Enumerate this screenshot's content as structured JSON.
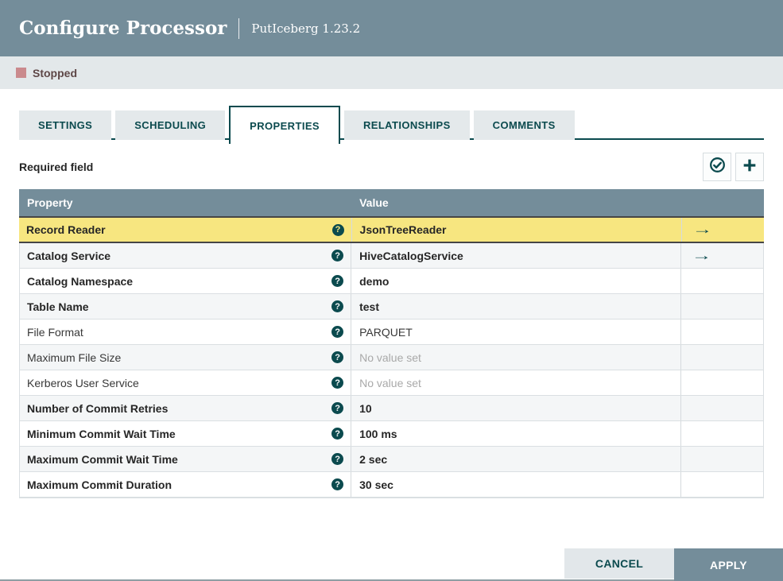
{
  "dialog": {
    "title": "Configure Processor",
    "subtitle": "PutIceberg 1.23.2"
  },
  "status_bar": {
    "label": "Stopped"
  },
  "tabs": [
    {
      "label": "SETTINGS",
      "active": false
    },
    {
      "label": "SCHEDULING",
      "active": false
    },
    {
      "label": "PROPERTIES",
      "active": true
    },
    {
      "label": "RELATIONSHIPS",
      "active": false
    },
    {
      "label": "COMMENTS",
      "active": false
    }
  ],
  "toolbar": {
    "required_field_label": "Required field",
    "buttons": [
      {
        "icon": "verify-properties-icon"
      },
      {
        "icon": "add-property-icon"
      }
    ]
  },
  "icons": {
    "help": "?",
    "goto_arrow": "→",
    "stopped": "stop-square"
  },
  "table": {
    "columns": {
      "property": "Property",
      "value": "Value"
    },
    "rows": [
      {
        "property": "Record Reader",
        "value": "JsonTreeReader",
        "bold": true,
        "unset": false,
        "goto": true,
        "selected": true
      },
      {
        "property": "Catalog Service",
        "value": "HiveCatalogService",
        "bold": true,
        "unset": false,
        "goto": true,
        "selected": false
      },
      {
        "property": "Catalog Namespace",
        "value": "demo",
        "bold": true,
        "unset": false,
        "goto": false,
        "selected": false
      },
      {
        "property": "Table Name",
        "value": "test",
        "bold": true,
        "unset": false,
        "goto": false,
        "selected": false
      },
      {
        "property": "File Format",
        "value": "PARQUET",
        "bold": false,
        "unset": false,
        "goto": false,
        "selected": false
      },
      {
        "property": "Maximum File Size",
        "value": "No value set",
        "bold": false,
        "unset": true,
        "goto": false,
        "selected": false
      },
      {
        "property": "Kerberos User Service",
        "value": "No value set",
        "bold": false,
        "unset": true,
        "goto": false,
        "selected": false
      },
      {
        "property": "Number of Commit Retries",
        "value": "10",
        "bold": true,
        "unset": false,
        "goto": false,
        "selected": false
      },
      {
        "property": "Minimum Commit Wait Time",
        "value": "100 ms",
        "bold": true,
        "unset": false,
        "goto": false,
        "selected": false
      },
      {
        "property": "Maximum Commit Wait Time",
        "value": "2 sec",
        "bold": true,
        "unset": false,
        "goto": false,
        "selected": false
      },
      {
        "property": "Maximum Commit Duration",
        "value": "30 sec",
        "bold": true,
        "unset": false,
        "goto": false,
        "selected": false
      }
    ]
  },
  "footer": {
    "cancel_label": "CANCEL",
    "apply_label": "APPLY"
  },
  "colors": {
    "header_bg": "#748D9A",
    "status_bg": "#E3E8EA",
    "stopped_square": "#CA8A8D",
    "accent_teal": "#0B4A4E",
    "selected_row_bg": "#F7E680",
    "selected_row_border": "#464646",
    "alt_row_bg": "#F4F6F7",
    "unset_text": "#A9A9A9",
    "apply_btn_bg": "#748D9A",
    "cancel_btn_bg": "#E2E7EA"
  }
}
